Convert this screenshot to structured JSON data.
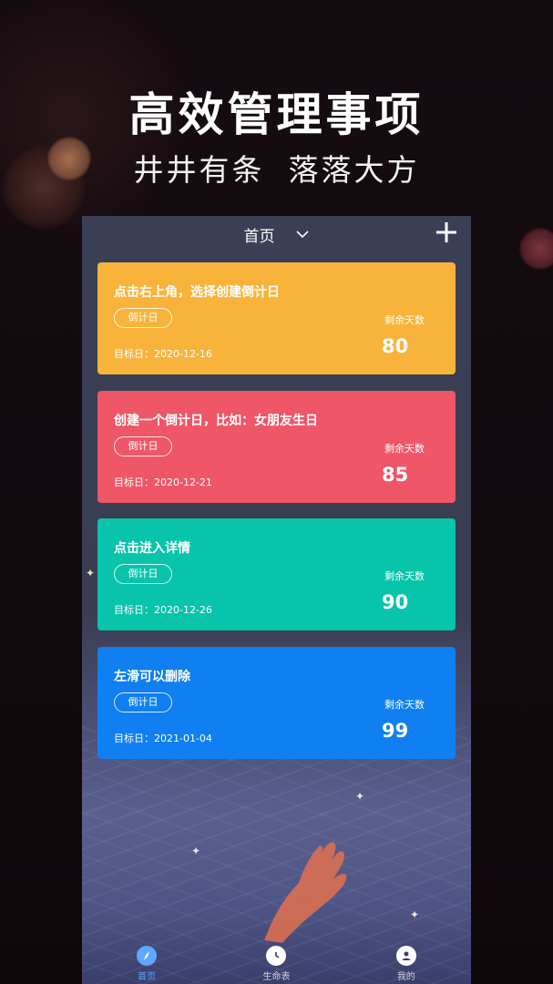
{
  "promo": {
    "headline": "高效管理事项",
    "subline_left": "井井有条",
    "subline_right": "落落大方"
  },
  "topbar": {
    "title": "首页"
  },
  "cards": [
    {
      "title": "点击右上角，选择创建倒计日",
      "tag": "倒计日",
      "date": "目标日：2020-12-16",
      "remain_label": "剩余天数",
      "days": "80",
      "color": "#f8b33b"
    },
    {
      "title": "创建一个倒计日，比如：女朋友生日",
      "tag": "倒计日",
      "date": "目标日：2020-12-21",
      "remain_label": "剩余天数",
      "days": "85",
      "color": "#ef5667"
    },
    {
      "title": "点击进入详情",
      "tag": "倒计日",
      "date": "目标日：2020-12-26",
      "remain_label": "剩余天数",
      "days": "90",
      "color": "#07c4aa"
    },
    {
      "title": "左滑可以删除",
      "tag": "倒计日",
      "date": "目标日：2021-01-04",
      "remain_label": "剩余天数",
      "days": "99",
      "color": "#0f7ff2"
    }
  ],
  "tabs": [
    {
      "label": "首页",
      "icon": "compass-icon",
      "active": true
    },
    {
      "label": "生命表",
      "icon": "clock-icon",
      "active": false
    },
    {
      "label": "我的",
      "icon": "user-icon",
      "active": false
    }
  ],
  "colors": {
    "accent_tab": "#5fa8ff",
    "app_bg": "#3b3f55"
  }
}
